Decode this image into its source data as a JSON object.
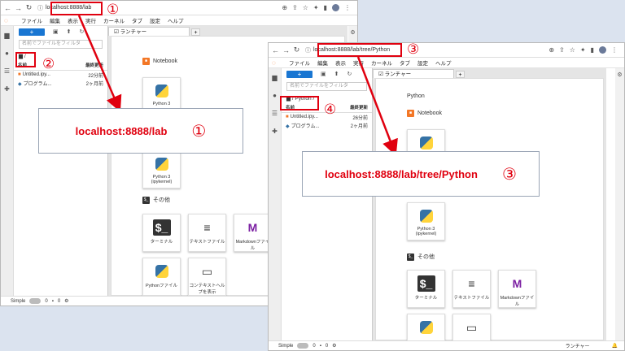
{
  "win1": {
    "url_host": "localhost:8888/lab",
    "menu": [
      "ファイル",
      "編集",
      "表示",
      "実行",
      "カーネル",
      "タブ",
      "設定",
      "ヘルプ"
    ],
    "new_label": "+",
    "filter_placeholder": "名前でファイルをフィルタ",
    "breadcrumb": "/",
    "col_name": "名前",
    "col_modified": "最終更新",
    "files": [
      {
        "name": "Untitled.ipy...",
        "modified": "22分前"
      },
      {
        "name": "プログラム...",
        "modified": "2ヶ月前"
      }
    ],
    "tab_label": "ランチャー",
    "notebook_label": "Notebook",
    "notebook_card": "Python 3",
    "notebook_card2": "Python 3 (ipykernel)",
    "other_label": "その他",
    "other_cards": [
      "ターミナル",
      "テキストファイル",
      "Markdownファイル",
      "Pythonファイル",
      "コンテキストヘルプを表示"
    ],
    "status_mode": "Simple",
    "status_a": "0",
    "status_b": "0"
  },
  "win2": {
    "url_host": "localhost:8888/lab/tree/Python",
    "menu": [
      "ファイル",
      "編集",
      "表示",
      "実行",
      "カーネル",
      "タブ",
      "設定",
      "ヘルプ"
    ],
    "new_label": "+",
    "filter_placeholder": "名前でファイルをフィルタ",
    "breadcrumb": "/ Python /",
    "col_name": "名前",
    "col_modified": "最終更新",
    "files": [
      {
        "name": "Untitled.ipy...",
        "modified": "26分前"
      },
      {
        "name": "プログラム...",
        "modified": "2ヶ月前"
      }
    ],
    "tab_label": "ランチャー",
    "section_python": "Python",
    "notebook_label": "Notebook",
    "notebook_card2": "Python 3 (ipykernel)",
    "other_label": "その他",
    "other_cards": [
      "ターミナル",
      "テキストファイル",
      "Markdownファイル"
    ],
    "status_mode": "Simple",
    "status_a": "0",
    "status_b": "0",
    "status_right": "ランチャー"
  },
  "annotations": {
    "n1": "①",
    "n2": "②",
    "n3": "③",
    "n4": "④",
    "callout1_text": "localhost:8888/lab",
    "callout1_num": "①",
    "callout3_text": "localhost:8888/lab/tree/Python",
    "callout3_num": "③"
  },
  "colors": {
    "annotation": "#e0000f",
    "accent": "#1976d2",
    "jupyter": "#f37726"
  }
}
